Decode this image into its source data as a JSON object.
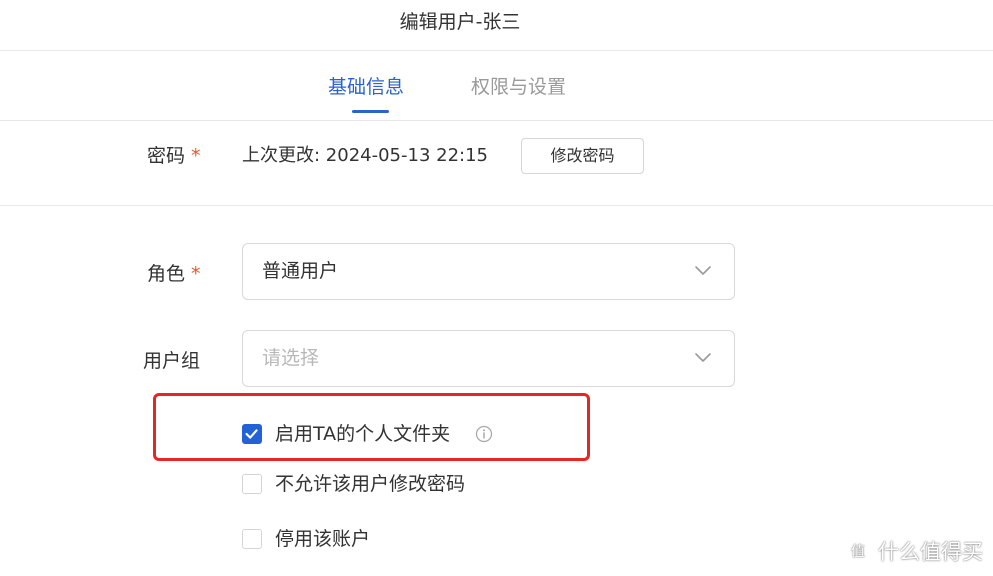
{
  "header": {
    "title": "编辑用户-张三"
  },
  "tabs": [
    {
      "label": "基础信息",
      "active": true
    },
    {
      "label": "权限与设置",
      "active": false
    }
  ],
  "password": {
    "label": "密码",
    "required_mark": "*",
    "last_changed": "上次更改: 2024-05-13 22:15",
    "change_button": "修改密码"
  },
  "role": {
    "label": "角色",
    "required_mark": "*",
    "value": "普通用户"
  },
  "user_group": {
    "label": "用户组",
    "placeholder": "请选择"
  },
  "options": [
    {
      "label": "启用TA的个人文件夹",
      "checked": true,
      "has_info_icon": true
    },
    {
      "label": "不允许该用户修改密码",
      "checked": false
    },
    {
      "label": "停用该账户",
      "checked": false
    }
  ],
  "watermark": {
    "text": "什么值得买"
  },
  "colors": {
    "accent": "#2a62cf",
    "required": "#e8542e",
    "highlight": "#e52622"
  },
  "icons": {
    "dropdown": "chevron-down-icon",
    "checkbox_checked": "check-icon",
    "info": "info-icon",
    "watermark_logo": "smzdm-logo-icon"
  }
}
